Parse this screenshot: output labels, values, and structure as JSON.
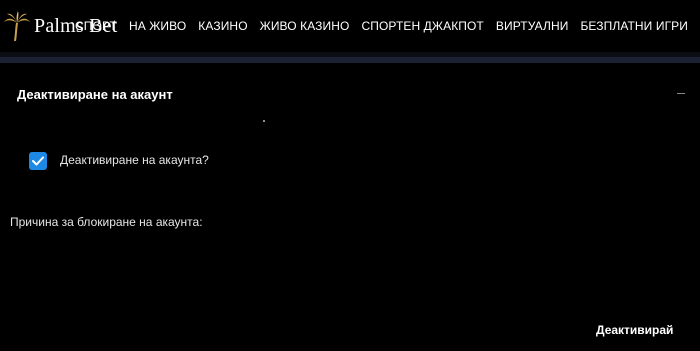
{
  "header": {
    "logo_text": "Palms Bet",
    "nav": [
      {
        "label": "СПОРТ"
      },
      {
        "label": "НА ЖИВО"
      },
      {
        "label": "КАЗИНО"
      },
      {
        "label": "ЖИВО КАЗИНО"
      },
      {
        "label": "СПОРТЕН ДЖАКПОТ"
      },
      {
        "label": "ВИРТУАЛНИ"
      },
      {
        "label": "БЕЗПЛАТНИ ИГРИ"
      }
    ]
  },
  "section": {
    "title": "Деактивиране на акаунт",
    "checkbox_label": "Деактивиране на акаунта?",
    "checkbox_checked": true,
    "reason_label": "Причина за блокиране на акаунта:",
    "submit_label": "Деактивирай"
  },
  "colors": {
    "background": "#000000",
    "checkbox_accent": "#1e88e5",
    "logo_palm": "#c9a24a"
  },
  "icons": [
    "palm-tree-icon",
    "checkmark-icon",
    "collapse-icon"
  ]
}
